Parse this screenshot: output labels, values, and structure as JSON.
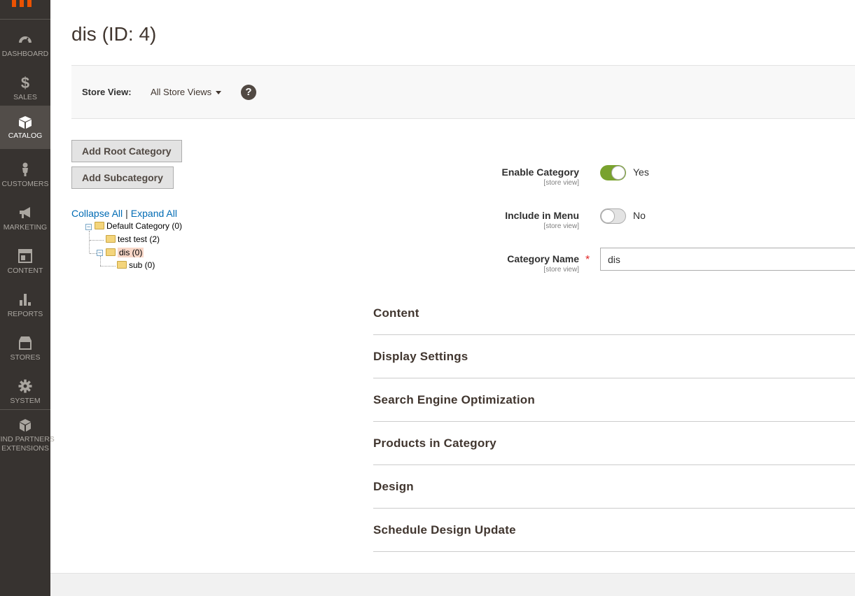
{
  "sidebar": {
    "items": [
      {
        "label": "DASHBOARD",
        "icon": "speedometer-icon"
      },
      {
        "label": "SALES",
        "icon": "dollar-icon"
      },
      {
        "label": "CATALOG",
        "icon": "box-icon"
      },
      {
        "label": "CUSTOMERS",
        "icon": "person-icon"
      },
      {
        "label": "MARKETING",
        "icon": "megaphone-icon"
      },
      {
        "label": "CONTENT",
        "icon": "layout-icon"
      },
      {
        "label": "REPORTS",
        "icon": "bar-chart-icon"
      },
      {
        "label": "STORES",
        "icon": "storefront-icon"
      },
      {
        "label": "SYSTEM",
        "icon": "gear-icon"
      },
      {
        "label": "FIND PARTNERS",
        "label2": "EXTENSIONS",
        "icon": "cubes-icon"
      }
    ]
  },
  "page": {
    "title": "dis (ID: 4)"
  },
  "store_view": {
    "label": "Store View:",
    "selected": "All Store Views",
    "help": "?"
  },
  "buttons": {
    "add_root": "Add Root Category",
    "add_sub": "Add Subcategory"
  },
  "tree": {
    "collapse_all": "Collapse All",
    "separator": "|",
    "expand_all": "Expand All",
    "nodes": [
      {
        "label": "Default Category (0)"
      },
      {
        "label": "test test (2)"
      },
      {
        "label": "dis (0)"
      },
      {
        "label": "sub (0)"
      }
    ]
  },
  "form": {
    "enable_category": {
      "label": "Enable Category",
      "scope": "[store view]",
      "value": "Yes"
    },
    "include_in_menu": {
      "label": "Include in Menu",
      "scope": "[store view]",
      "value": "No"
    },
    "category_name": {
      "label": "Category Name",
      "scope": "[store view]",
      "value": "dis",
      "required": "*"
    }
  },
  "sections": [
    "Content",
    "Display Settings",
    "Search Engine Optimization",
    "Products in Category",
    "Design",
    "Schedule Design Update"
  ],
  "colors": {
    "sidebar_bg": "#373330",
    "accent_orange": "#eb5202",
    "toggle_on": "#79a22e",
    "link_blue": "#006bb4"
  }
}
